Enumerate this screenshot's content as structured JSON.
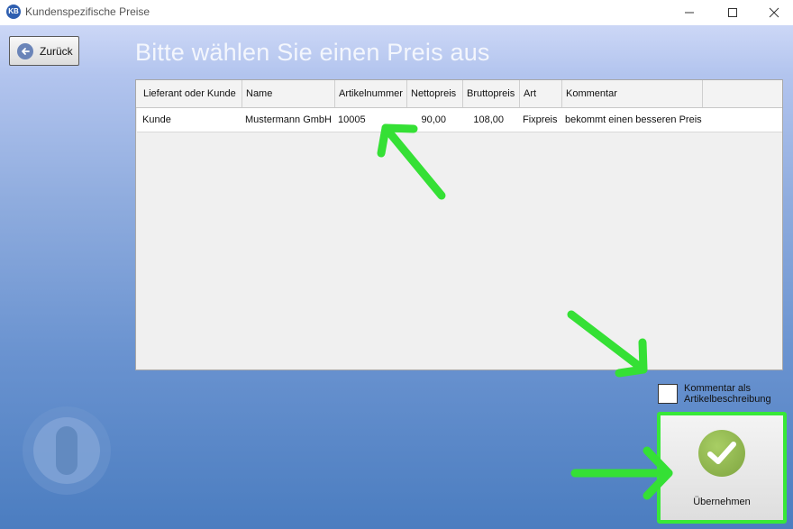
{
  "window": {
    "title": "Kundenspezifische Preise",
    "app_icon_text": "KB"
  },
  "toolbar": {
    "back_label": "Zurück"
  },
  "page": {
    "heading": "Bitte wählen Sie einen Preis aus"
  },
  "table": {
    "columns": [
      "Lieferant oder Kunde",
      "Name",
      "Artikelnummer",
      "Nettopreis",
      "Bruttopreis",
      "Art",
      "Kommentar"
    ],
    "rows": [
      [
        "Kunde",
        "Mustermann GmbH",
        "10005",
        "90,00",
        "108,00",
        "Fixpreis",
        "bekommt einen besseren Preis"
      ]
    ]
  },
  "options": {
    "comment_as_description_label": "Kommentar als Artikelbeschreibung",
    "comment_as_description_checked": false
  },
  "actions": {
    "apply_label": "Übernehmen"
  },
  "colors": {
    "highlight": "#38e838",
    "apply_icon": "#8ab24a"
  },
  "icons": {
    "app": "kb-logo-icon",
    "back": "arrow-left-icon",
    "apply": "checkmark-icon",
    "decoration": "power-icon",
    "minimize": "minimize-icon",
    "maximize": "maximize-icon",
    "close": "close-icon"
  }
}
